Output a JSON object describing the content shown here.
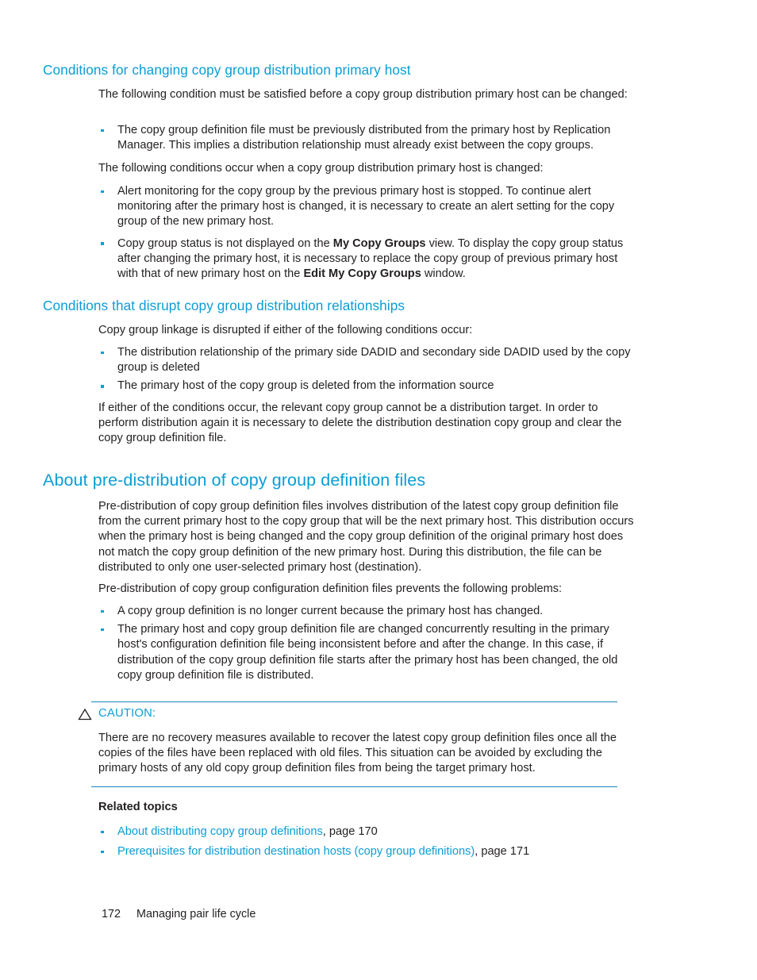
{
  "sections": [
    {
      "heading": "Conditions for changing copy group distribution primary host",
      "paragraph_1": "The following condition must be satisfied before a copy group distribution primary host can be changed:",
      "bullets_1": [
        "The copy group definition file must be previously distributed from the primary host by Replication Manager. This implies a distribution relationship must already exist between the copy groups."
      ],
      "paragraph_2": "The following conditions occur when a copy group distribution primary host is changed:",
      "bullets_2": [
        {
          "parts": [
            {
              "text": "Alert monitoring for the copy group by the previous primary host is stopped. To continue alert monitoring after the primary host is changed, it is necessary to create an alert setting for the copy group of the new primary host.",
              "bold": false
            }
          ]
        },
        {
          "parts": [
            {
              "text": "Copy group status is not displayed on the ",
              "bold": false
            },
            {
              "text": "My Copy Groups",
              "bold": true
            },
            {
              "text": " view. To display the copy group status after changing the primary host, it is necessary to replace the copy group of previous primary host with that of new primary host on the ",
              "bold": false
            },
            {
              "text": "Edit My Copy Groups",
              "bold": true
            },
            {
              "text": " window.",
              "bold": false
            }
          ]
        }
      ]
    },
    {
      "heading": "Conditions that disrupt copy group distribution relationships",
      "paragraph_1": "Copy group linkage is disrupted if either of the following conditions occur:",
      "bullets_1": [
        "The distribution relationship of the primary side DADID and secondary side DADID used by the copy group is deleted",
        "The primary host of the copy group is deleted from the information source"
      ],
      "paragraph_2": "If either of the conditions occur, the relevant copy group cannot be a distribution target. In order to perform distribution again it is necessary to delete the distribution destination copy group and clear the copy group definition file."
    },
    {
      "heading": "About pre-distribution of copy group definition files",
      "paragraph_1": "Pre-distribution of copy group definition files involves distribution of the latest copy group definition file from the current primary host to the copy group that will be the next primary host. This distribution occurs when the primary host is being changed and the copy group definition of the original primary host does not match the copy group definition of the new primary host. During this distribution, the file can be distributed to only one user-selected primary host (destination).",
      "paragraph_2": "Pre-distribution of copy group configuration definition files prevents the following problems:",
      "bullets_1": [
        "A copy group definition is no longer current because the primary host has changed.",
        "The primary host and copy group definition file are changed concurrently resulting in the primary host's configuration definition file being inconsistent before and after the change. In this case, if distribution of the copy group definition file starts after the primary host has been changed, the old copy group definition file is distributed."
      ]
    }
  ],
  "caution": {
    "icon": "warning-triangle-icon",
    "label": "CAUTION:",
    "body": "There are no recovery measures available to recover the latest copy group definition files once all the copies of the files have been replaced with old files. This situation can be avoided by excluding the primary hosts of any old copy group definition files from being the target primary host."
  },
  "related_topics": {
    "title": "Related topics",
    "items": [
      {
        "link": "About distributing copy group definitions",
        "suffix": ", page 170"
      },
      {
        "link": "Prerequisites for distribution destination hosts (copy group definitions)",
        "suffix": ", page 171"
      }
    ]
  },
  "footer": {
    "page_number": "172",
    "chapter": "Managing pair life cycle"
  },
  "colors": {
    "heading_blue": "#0b9dd6",
    "rule_blue": "#1287bd",
    "body_text": "#231f20"
  }
}
